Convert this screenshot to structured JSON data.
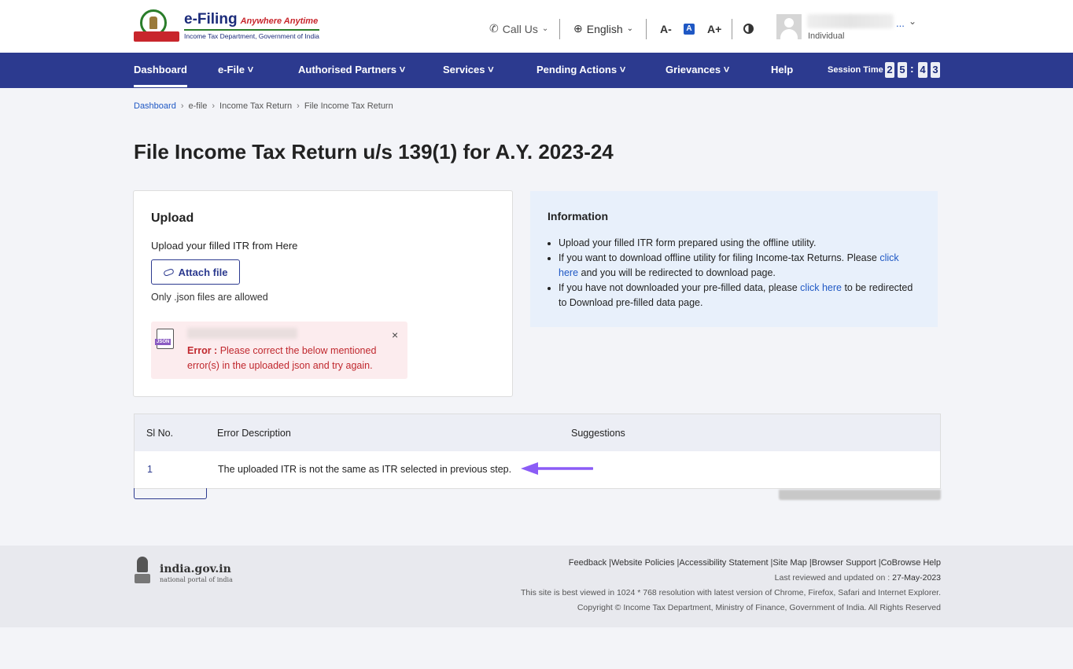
{
  "header": {
    "logo_title": "e-Filing",
    "logo_tagline": "Anywhere Anytime",
    "logo_subtitle": "Income Tax Department, Government of India",
    "call_us": "Call Us",
    "language": "English",
    "font_decrease": "A-",
    "font_normal": "A",
    "font_increase": "A+",
    "user_ellipsis": "...",
    "user_role": "Individual"
  },
  "nav": {
    "items": [
      {
        "label": "Dashboard"
      },
      {
        "label": "e-File ˅"
      },
      {
        "label": "Authorised Partners ˅"
      },
      {
        "label": "Services ˅"
      },
      {
        "label": "Pending Actions ˅"
      },
      {
        "label": "Grievances ˅"
      },
      {
        "label": "Help"
      }
    ],
    "session_label": "Session Time",
    "session_digits": [
      "2",
      "5",
      "4",
      "3"
    ]
  },
  "breadcrumb": [
    "Dashboard",
    "e-file",
    "Income Tax Return",
    "File Income Tax Return"
  ],
  "page_title": "File Income Tax Return u/s 139(1) for A.Y. 2023-24",
  "upload": {
    "title": "Upload",
    "subtitle": "Upload your filled ITR from Here",
    "attach_label": "Attach file",
    "allowed_note": "Only .json files are allowed",
    "json_icon_label": "JSON",
    "error_prefix": "Error :",
    "error_message": "Please correct the below mentioned error(s) in the uploaded json and try again."
  },
  "info": {
    "title": "Information",
    "item1": "Upload your filled ITR form prepared using the offline utility.",
    "item2_pre": "If you want to download offline utility for filing Income-tax Returns. Please",
    "item2_link": "click here",
    "item2_post": "and you will be redirected to download page.",
    "item3_pre": "If you have not downloaded your pre-filled data, please",
    "item3_link": "click here",
    "item3_post": "to be redirected to Download pre-filled data page."
  },
  "error_table": {
    "headers": [
      "Sl No.",
      "Error Description",
      "Suggestions"
    ],
    "rows": [
      {
        "sl": "1",
        "description": "The uploaded ITR is not the same as ITR selected in previous step.",
        "suggestion": ""
      }
    ]
  },
  "footer": {
    "portal_name": "india.gov.in",
    "portal_sub": "national portal of india",
    "links": "Feedback |Website Policies |Accessibility Statement |Site Map |Browser Support |CoBrowse Help",
    "last_reviewed_label": "Last reviewed and updated on :",
    "last_reviewed_date": "27-May-2023",
    "resolution_note": "This site is best viewed in 1024 * 768 resolution with latest version of Chrome, Firefox, Safari and Internet Explorer.",
    "copyright": "Copyright © Income Tax Department, Ministry of Finance, Government of India. All Rights Reserved"
  },
  "colors": {
    "nav_bg": "#2c3a8f",
    "link": "#1f58c4",
    "error": "#c0282e",
    "annotation_arrow": "#8b5cf6"
  }
}
